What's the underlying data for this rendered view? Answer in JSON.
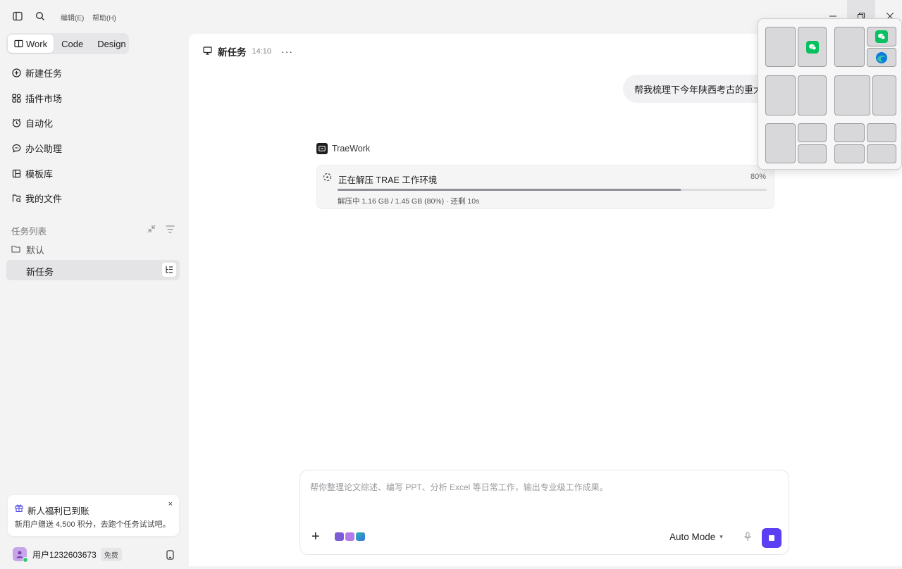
{
  "menu": {
    "edit": "编辑(E)",
    "help": "帮助(H)"
  },
  "modes": [
    "Work",
    "Code",
    "Design"
  ],
  "nav": [
    "新建任务",
    "插件市场",
    "自动化",
    "办公助理",
    "模板库",
    "我的文件"
  ],
  "task_list": {
    "title": "任务列表",
    "folder": "默认",
    "active_task": "新任务"
  },
  "promo": {
    "title": "新人福利已到账",
    "desc": "新用户赠送 4,500 积分，去跑个任务试试吧。",
    "close": "×"
  },
  "user": {
    "name": "用户1232603673",
    "plan": "免费"
  },
  "chat": {
    "title": "新任务",
    "time": "14:10",
    "more": "···",
    "user_message": "帮我梳理下今年陕西考古的重大成果",
    "agent_name": "TraeWork",
    "progress": {
      "label": "正在解压 TRAE 工作环境",
      "percent_text": "80%",
      "fraction": 0.8,
      "detail": "解压中 1.16 GB / 1.45 GB (80%) · 还剩 10s"
    }
  },
  "composer": {
    "placeholder": "帮你整理论文综述、编写 PPT、分析 Excel 等日常工作，输出专业级工作成果。",
    "plus": "+",
    "mode": "Auto Mode"
  },
  "colors": {
    "accent": "#5b3ff2",
    "wechat": "#07c160",
    "edge": "#0c7bd9"
  }
}
